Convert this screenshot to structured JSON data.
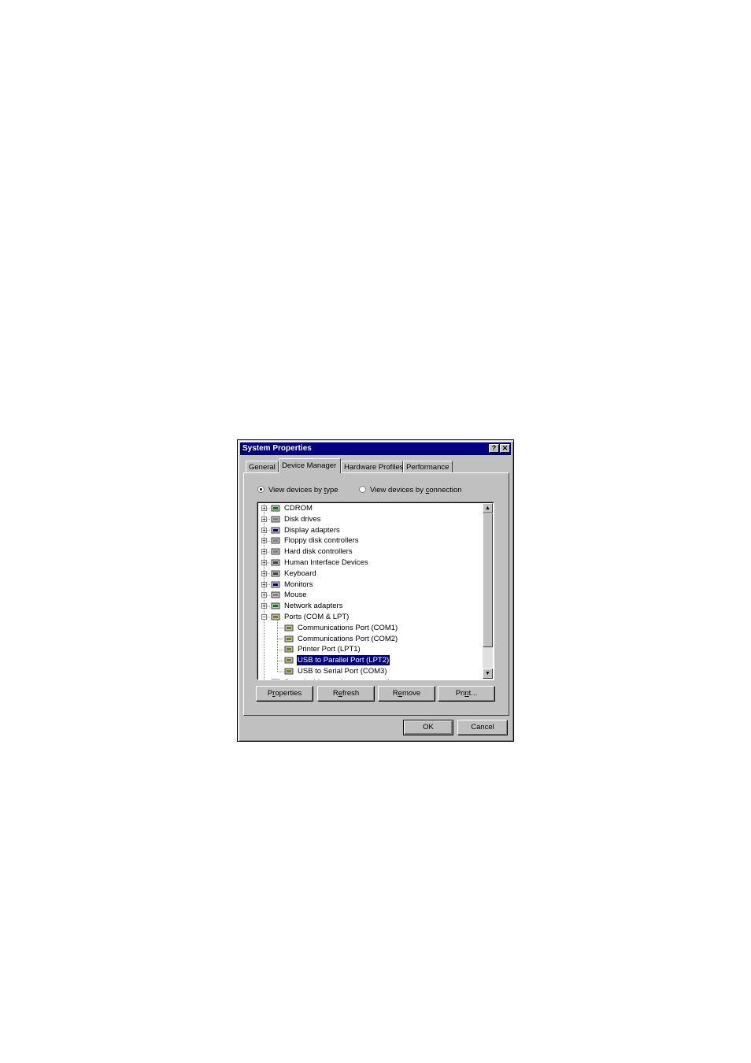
{
  "window": {
    "title": "System Properties",
    "help_button": "?",
    "close_button": "✕"
  },
  "tabs": [
    {
      "label": "General",
      "active": false
    },
    {
      "label": "Device Manager",
      "active": true
    },
    {
      "label": "Hardware Profiles",
      "active": false
    },
    {
      "label": "Performance",
      "active": false
    }
  ],
  "view_options": {
    "by_type": {
      "pre": "View devices by ",
      "acc": "t",
      "post": "ype",
      "selected": true
    },
    "by_connection": {
      "pre": "View devices by ",
      "acc": "c",
      "post": "onnection",
      "selected": false
    }
  },
  "device_tree": [
    {
      "label": "CDROM",
      "icon": "cdrom-icon",
      "expander": "+"
    },
    {
      "label": "Disk drives",
      "icon": "disk-drive-icon",
      "expander": "+"
    },
    {
      "label": "Display adapters",
      "icon": "display-adapter-icon",
      "expander": "+"
    },
    {
      "label": "Floppy disk controllers",
      "icon": "floppy-controller-icon",
      "expander": "+"
    },
    {
      "label": "Hard disk controllers",
      "icon": "hard-disk-controller-icon",
      "expander": "+"
    },
    {
      "label": "Human Interface Devices",
      "icon": "hid-icon",
      "expander": "+"
    },
    {
      "label": "Keyboard",
      "icon": "keyboard-icon",
      "expander": "+"
    },
    {
      "label": "Monitors",
      "icon": "monitor-icon",
      "expander": "+"
    },
    {
      "label": "Mouse",
      "icon": "mouse-icon",
      "expander": "+"
    },
    {
      "label": "Network adapters",
      "icon": "network-adapter-icon",
      "expander": "+"
    },
    {
      "label": "Ports (COM & LPT)",
      "icon": "port-icon",
      "expander": "−"
    },
    {
      "label": "Communications Port (COM1)",
      "icon": "port-icon",
      "child": true
    },
    {
      "label": "Communications Port (COM2)",
      "icon": "port-icon",
      "child": true
    },
    {
      "label": "Printer Port (LPT1)",
      "icon": "port-icon",
      "child": true
    },
    {
      "label": "USB to Parallel Port (LPT2)",
      "icon": "port-icon",
      "child": true,
      "selected": true
    },
    {
      "label": "USB to Serial Port (COM3)",
      "icon": "port-icon",
      "child": true
    },
    {
      "label": "Sound, video and game controllers",
      "icon": "sound-icon",
      "expander": "+"
    }
  ],
  "buttons": {
    "properties": {
      "pre": "P",
      "acc": "r",
      "post": "operties"
    },
    "refresh": {
      "pre": "R",
      "acc": "e",
      "post": "fresh"
    },
    "remove": {
      "pre": "R",
      "acc": "e",
      "post": "move"
    },
    "print": {
      "pre": "Pri",
      "acc": "n",
      "post": "t..."
    },
    "ok": "OK",
    "cancel": "Cancel"
  },
  "colors": {
    "title_bar": "#000080",
    "face": "#c0c0c0",
    "selection": "#000080"
  }
}
